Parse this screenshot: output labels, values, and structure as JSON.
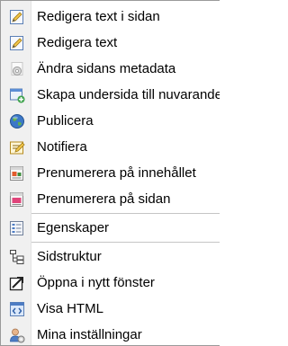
{
  "menu": {
    "items": [
      {
        "label": "Redigera text i sidan",
        "icon": "edit-page-icon"
      },
      {
        "label": "Redigera text",
        "icon": "edit-text-icon"
      },
      {
        "label": "Ändra sidans metadata",
        "icon": "metadata-gear-icon"
      },
      {
        "label": "Skapa undersida till nuvarande",
        "icon": "new-subpage-icon"
      },
      {
        "label": "Publicera",
        "icon": "publish-globe-icon"
      },
      {
        "label": "Notifiera",
        "icon": "notify-icon"
      },
      {
        "label": "Prenumerera på innehållet",
        "icon": "subscribe-content-icon"
      },
      {
        "label": "Prenumerera på sidan",
        "icon": "subscribe-page-icon"
      },
      {
        "label": "Egenskaper",
        "icon": "properties-icon"
      },
      {
        "label": "Sidstruktur",
        "icon": "site-structure-icon"
      },
      {
        "label": "Öppna i nytt fönster",
        "icon": "open-new-window-icon"
      },
      {
        "label": "Visa HTML",
        "icon": "view-html-icon"
      },
      {
        "label": "Mina inställningar",
        "icon": "user-settings-icon"
      }
    ]
  }
}
